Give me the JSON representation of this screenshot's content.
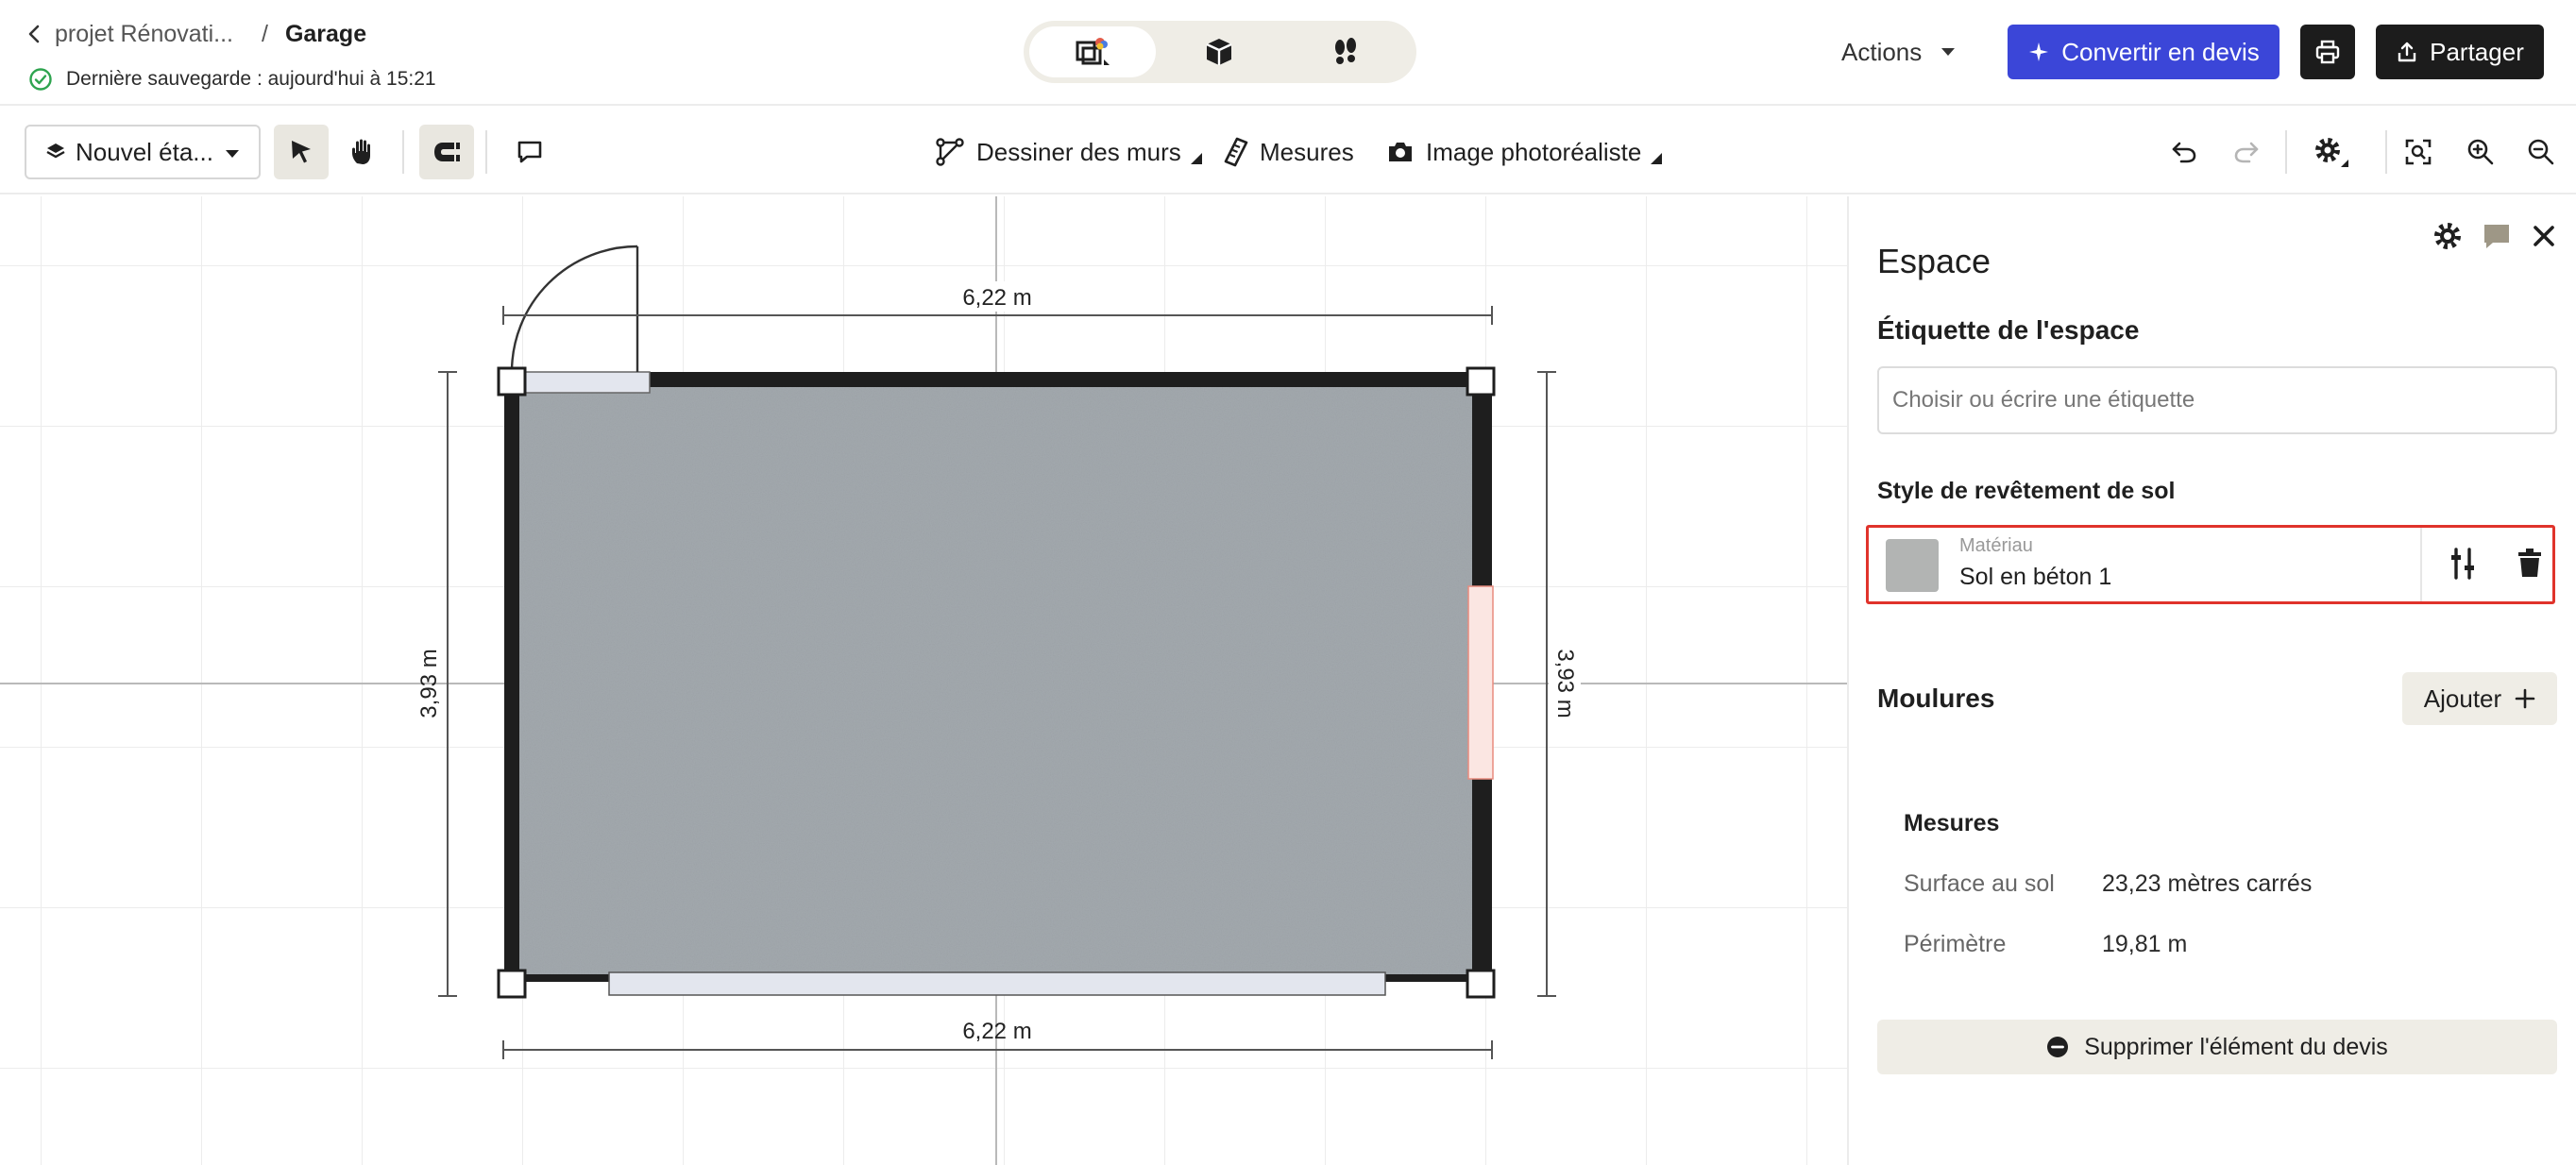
{
  "header": {
    "project_name": "projet Rénovati...",
    "separator": "/",
    "page_name": "Garage",
    "saved_text": "Dernière sauvegarde : aujourd'hui à 15:21",
    "actions_label": "Actions",
    "convert_label": "Convertir en devis",
    "share_label": "Partager",
    "view_modes": [
      "plan-2d-view",
      "3d-view",
      "walkthrough-view"
    ],
    "accent_color": "#3b46d8"
  },
  "toolbar": {
    "floor_label": "Nouvel éta...",
    "draw_walls_label": "Dessiner des murs",
    "measures_label": "Mesures",
    "photo_label": "Image photoréaliste"
  },
  "plan": {
    "dim_top": "6,22 m",
    "dim_bottom": "6,22 m",
    "dim_left": "3,93 m",
    "dim_right": "3,93 m"
  },
  "panel": {
    "title": "Espace",
    "label_heading": "Étiquette de l'espace",
    "label_placeholder": "Choisir ou écrire une étiquette",
    "floor_style_heading": "Style de revêtement de sol",
    "material_label": "Matériau",
    "material_name": "Sol en béton 1",
    "moldings_heading": "Moulures",
    "add_label": "Ajouter",
    "measures_heading": "Mesures",
    "measures": [
      {
        "key": "Surface au sol",
        "value": "23,23 mètres carrés"
      },
      {
        "key": "Périmètre",
        "value": "19,81 m"
      }
    ],
    "remove_label": "Supprimer l'élément du devis",
    "highlight_color": "#e0332b"
  }
}
